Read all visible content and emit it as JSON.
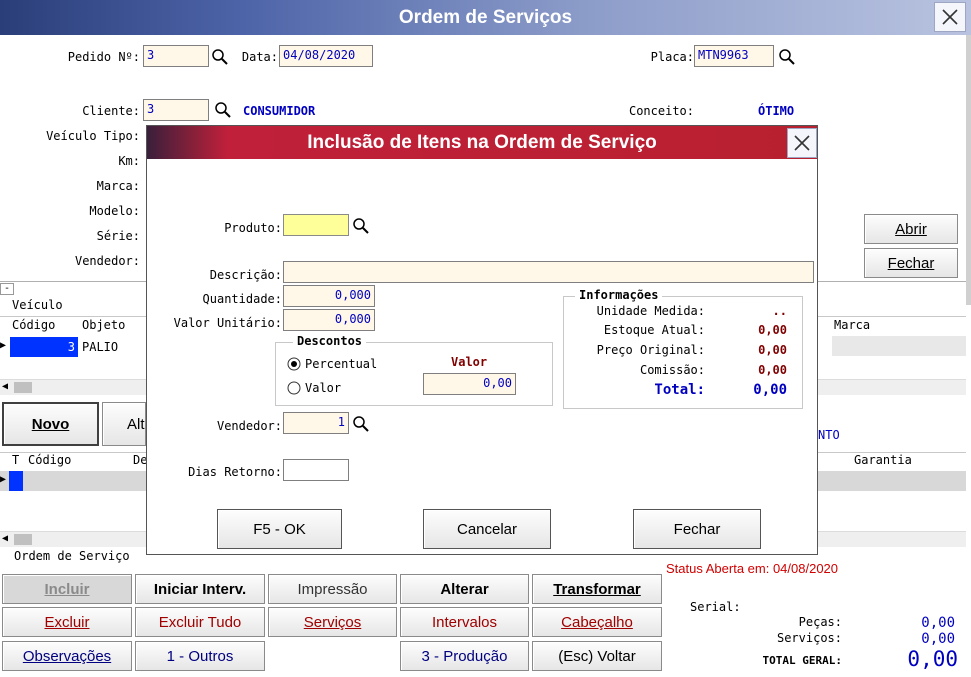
{
  "window": {
    "title": "Ordem de Serviços"
  },
  "header": {
    "pedido_label": "Pedido Nº:",
    "pedido_value": "3",
    "data_label": "Data:",
    "data_value": "04/08/2020",
    "placa_label": "Placa:",
    "placa_value": "MTN9963",
    "cliente_label": "Cliente:",
    "cliente_value": "3",
    "cliente_name": "CONSUMIDOR",
    "conceito_label": "Conceito:",
    "conceito_value": "ÓTIMO",
    "veiculo_tipo_label": "Veículo Tipo:",
    "km_label": "Km:",
    "marca_label": "Marca:",
    "modelo_label": "Modelo:",
    "serie_label": "Série:",
    "vendedor_label": "Vendedor:"
  },
  "side_buttons": {
    "abrir": "Abrir",
    "fechar": "Fechar"
  },
  "vehicle_grid": {
    "group_label": "Veículo",
    "columns": [
      "Código",
      "Objeto",
      "Marca"
    ],
    "rows": [
      {
        "codigo": "3",
        "objeto": "PALIO"
      }
    ]
  },
  "mid_buttons": {
    "novo": "Novo",
    "alt": "Alt"
  },
  "status_partial": "NTO",
  "items_grid": {
    "columns": [
      "T",
      "Código",
      "De",
      "Garantia"
    ]
  },
  "os_label": "Ordem de Serviço",
  "status_line": "Status Aberta em: 04/08/2020",
  "bottom_buttons": {
    "incluir": "Incluir",
    "iniciar": "Iniciar Interv.",
    "impressao": "Impressão",
    "alterar": "Alterar",
    "transformar": "Transformar",
    "excluir": "Excluir",
    "excluir_tudo": "Excluir Tudo",
    "servicos": "Serviços",
    "intervalos": "Intervalos",
    "cabecalho": "Cabeçalho",
    "observacoes": "Observações",
    "outros": "1 - Outros",
    "producao": "3 - Produção",
    "voltar": "(Esc) Voltar"
  },
  "totals": {
    "serial_label": "Serial:",
    "pecas_label": "Peças:",
    "pecas_value": "0,00",
    "servicos_label": "Serviços:",
    "servicos_value": "0,00",
    "total_label": "TOTAL GERAL:",
    "total_value": "0,00"
  },
  "dialog": {
    "title": "Inclusão de Itens na Ordem de Serviço",
    "produto_label": "Produto:",
    "produto_value": "",
    "descricao_label": "Descrição:",
    "descricao_value": "",
    "quantidade_label": "Quantidade:",
    "quantidade_value": "0,000",
    "valor_unitario_label": "Valor Unitário:",
    "valor_unitario_value": "0,000",
    "descontos": {
      "title": "Descontos",
      "valor_header": "Valor",
      "percentual_label": "Percentual",
      "valor_label": "Valor",
      "selected": "percentual",
      "valor_value": "0,00"
    },
    "informacoes": {
      "title": "Informações",
      "unidade_label": "Unidade Medida:",
      "unidade_value": "..",
      "estoque_label": "Estoque Atual:",
      "estoque_value": "0,00",
      "preco_label": "Preço Original:",
      "preco_value": "0,00",
      "comissao_label": "Comissão:",
      "comissao_value": "0,00",
      "total_label": "Total:",
      "total_value": "0,00"
    },
    "vendedor_label": "Vendedor:",
    "vendedor_value": "1",
    "dias_retorno_label": "Dias Retorno:",
    "dias_retorno_value": "",
    "buttons": {
      "ok": "F5 - OK",
      "cancelar": "Cancelar",
      "fechar": "Fechar"
    }
  },
  "colors": {
    "accent_blue": "#0000c0",
    "dialog_title": "#b8202f",
    "value_red": "#800000"
  }
}
